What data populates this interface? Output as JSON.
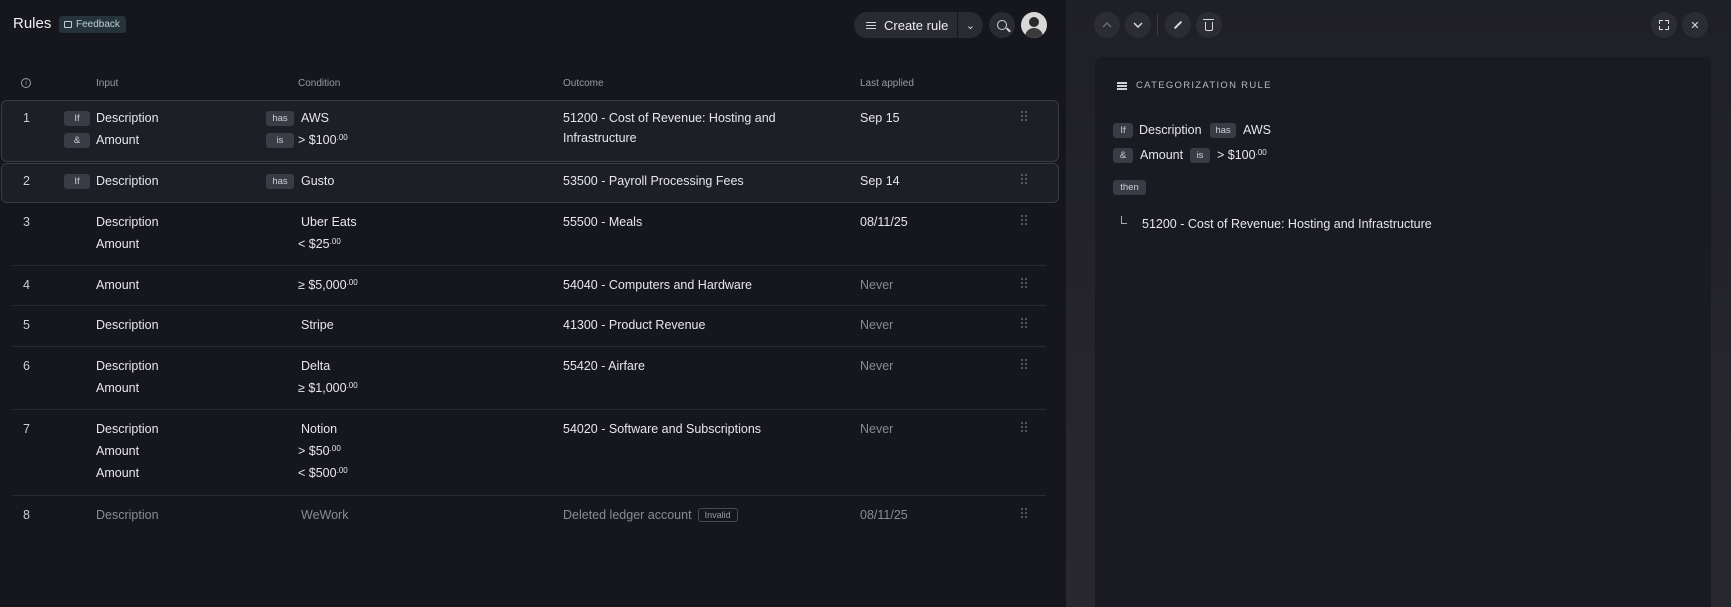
{
  "header": {
    "title": "Rules",
    "feedback_label": "Feedback",
    "create_rule_label": "Create rule",
    "dropdown_glyph": "⌄"
  },
  "table": {
    "columns": {
      "info": "i",
      "input": "Input",
      "condition": "Condition",
      "outcome": "Outcome",
      "last_applied": "Last applied"
    },
    "rows": [
      {
        "num": "1",
        "lines": [
          {
            "prefix": "If",
            "input": "Description",
            "op": "has",
            "cond": "AWS"
          },
          {
            "prefix": "&",
            "input": "Amount",
            "op": "is",
            "cond_main": "> $100",
            "cond_sup": ".00"
          }
        ],
        "outcome_l1": "51200 - Cost of Revenue: Hosting and",
        "outcome_l2": "Infrastructure",
        "last_applied": "Sep 15"
      },
      {
        "num": "2",
        "lines": [
          {
            "prefix": "If",
            "input": "Description",
            "op": "has",
            "cond": "Gusto"
          }
        ],
        "outcome": "53500 - Payroll Processing Fees",
        "last_applied": "Sep 14"
      },
      {
        "num": "3",
        "lines": [
          {
            "input": "Description",
            "cond": "Uber Eats"
          },
          {
            "input": "Amount",
            "cond_main": "< $25",
            "cond_sup": ".00"
          }
        ],
        "outcome": "55500 - Meals",
        "last_applied": "08/11/25"
      },
      {
        "num": "4",
        "lines": [
          {
            "input": "Amount",
            "cond_main": "≥ $5,000",
            "cond_sup": ".00"
          }
        ],
        "outcome": "54040 - Computers and Hardware",
        "last_applied": "Never"
      },
      {
        "num": "5",
        "lines": [
          {
            "input": "Description",
            "cond": "Stripe"
          }
        ],
        "outcome": "41300 - Product Revenue",
        "last_applied": "Never"
      },
      {
        "num": "6",
        "lines": [
          {
            "input": "Description",
            "cond": "Delta"
          },
          {
            "input": "Amount",
            "cond_main": "≥ $1,000",
            "cond_sup": ".00"
          }
        ],
        "outcome": "55420 - Airfare",
        "last_applied": "Never"
      },
      {
        "num": "7",
        "lines": [
          {
            "input": "Description",
            "cond": "Notion"
          },
          {
            "input": "Amount",
            "cond_main": "> $50",
            "cond_sup": ".00"
          },
          {
            "input": "Amount",
            "cond_main": "< $500",
            "cond_sup": ".00"
          }
        ],
        "outcome": "54020 - Software and Subscriptions",
        "last_applied": "Never"
      },
      {
        "num": "8",
        "lines": [
          {
            "input": "Description",
            "cond": "WeWork"
          }
        ],
        "outcome": "Deleted ledger account",
        "badge": "Invalid",
        "last_applied": "08/11/25"
      }
    ]
  },
  "detail": {
    "title": "CATEGORIZATION RULE",
    "if_label": "If",
    "and_label": "&",
    "line1_input": "Description",
    "line1_op": "has",
    "line1_value": "AWS",
    "line2_input": "Amount",
    "line2_op": "is",
    "line2_value_main": "> $100",
    "line2_value_sup": ".00",
    "then_label": "then",
    "outcome": "51200 - Cost of Revenue: Hosting and Infrastructure"
  },
  "icons": {
    "up": "chevron-up-icon",
    "down": "chevron-down-icon",
    "edit": "pencil-icon",
    "delete": "trash-icon",
    "expand": "expand-icon",
    "close": "close-icon",
    "close_glyph": "✕"
  }
}
